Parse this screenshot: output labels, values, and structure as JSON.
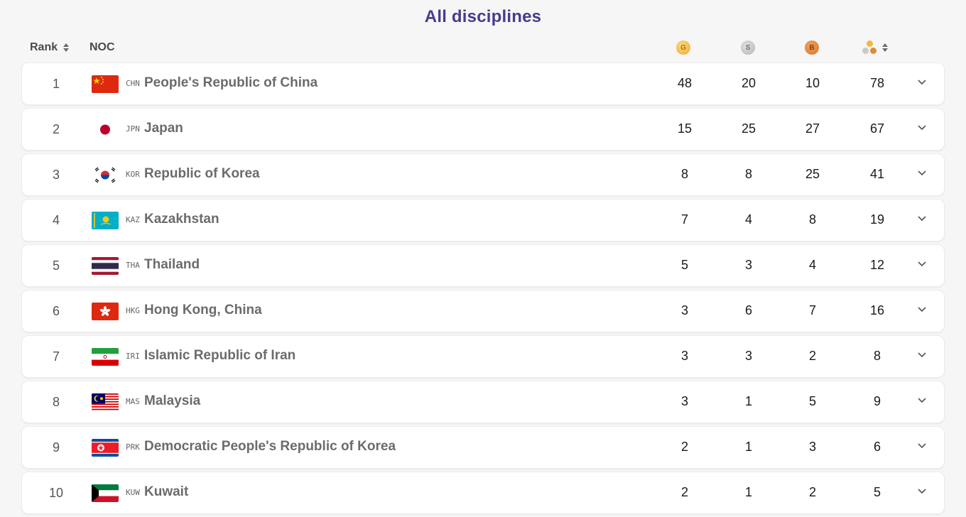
{
  "title": "All disciplines",
  "header": {
    "rank_label": "Rank",
    "noc_label": "NOC",
    "gold_letter": "G",
    "silver_letter": "S",
    "bronze_letter": "B"
  },
  "colors": {
    "title": "#4a3a8c",
    "gold": "#f3b843",
    "silver": "#c9c9c9",
    "bronze": "#e0893a"
  },
  "rows": [
    {
      "rank": "1",
      "code": "CHN",
      "name": "People's Republic of China",
      "gold": "48",
      "silver": "20",
      "bronze": "10",
      "total": "78",
      "flag": "china-flag"
    },
    {
      "rank": "2",
      "code": "JPN",
      "name": "Japan",
      "gold": "15",
      "silver": "25",
      "bronze": "27",
      "total": "67",
      "flag": "japan-flag"
    },
    {
      "rank": "3",
      "code": "KOR",
      "name": "Republic of Korea",
      "gold": "8",
      "silver": "8",
      "bronze": "25",
      "total": "41",
      "flag": "korea-flag"
    },
    {
      "rank": "4",
      "code": "KAZ",
      "name": "Kazakhstan",
      "gold": "7",
      "silver": "4",
      "bronze": "8",
      "total": "19",
      "flag": "kazakhstan-flag"
    },
    {
      "rank": "5",
      "code": "THA",
      "name": "Thailand",
      "gold": "5",
      "silver": "3",
      "bronze": "4",
      "total": "12",
      "flag": "thailand-flag"
    },
    {
      "rank": "6",
      "code": "HKG",
      "name": "Hong Kong, China",
      "gold": "3",
      "silver": "6",
      "bronze": "7",
      "total": "16",
      "flag": "hong-kong-flag"
    },
    {
      "rank": "7",
      "code": "IRI",
      "name": "Islamic Republic of Iran",
      "gold": "3",
      "silver": "3",
      "bronze": "2",
      "total": "8",
      "flag": "iran-flag"
    },
    {
      "rank": "8",
      "code": "MAS",
      "name": "Malaysia",
      "gold": "3",
      "silver": "1",
      "bronze": "5",
      "total": "9",
      "flag": "malaysia-flag"
    },
    {
      "rank": "9",
      "code": "PRK",
      "name": "Democratic People's Republic of Korea",
      "gold": "2",
      "silver": "1",
      "bronze": "3",
      "total": "6",
      "flag": "dpr-korea-flag"
    },
    {
      "rank": "10",
      "code": "KUW",
      "name": "Kuwait",
      "gold": "2",
      "silver": "1",
      "bronze": "2",
      "total": "5",
      "flag": "kuwait-flag"
    }
  ]
}
